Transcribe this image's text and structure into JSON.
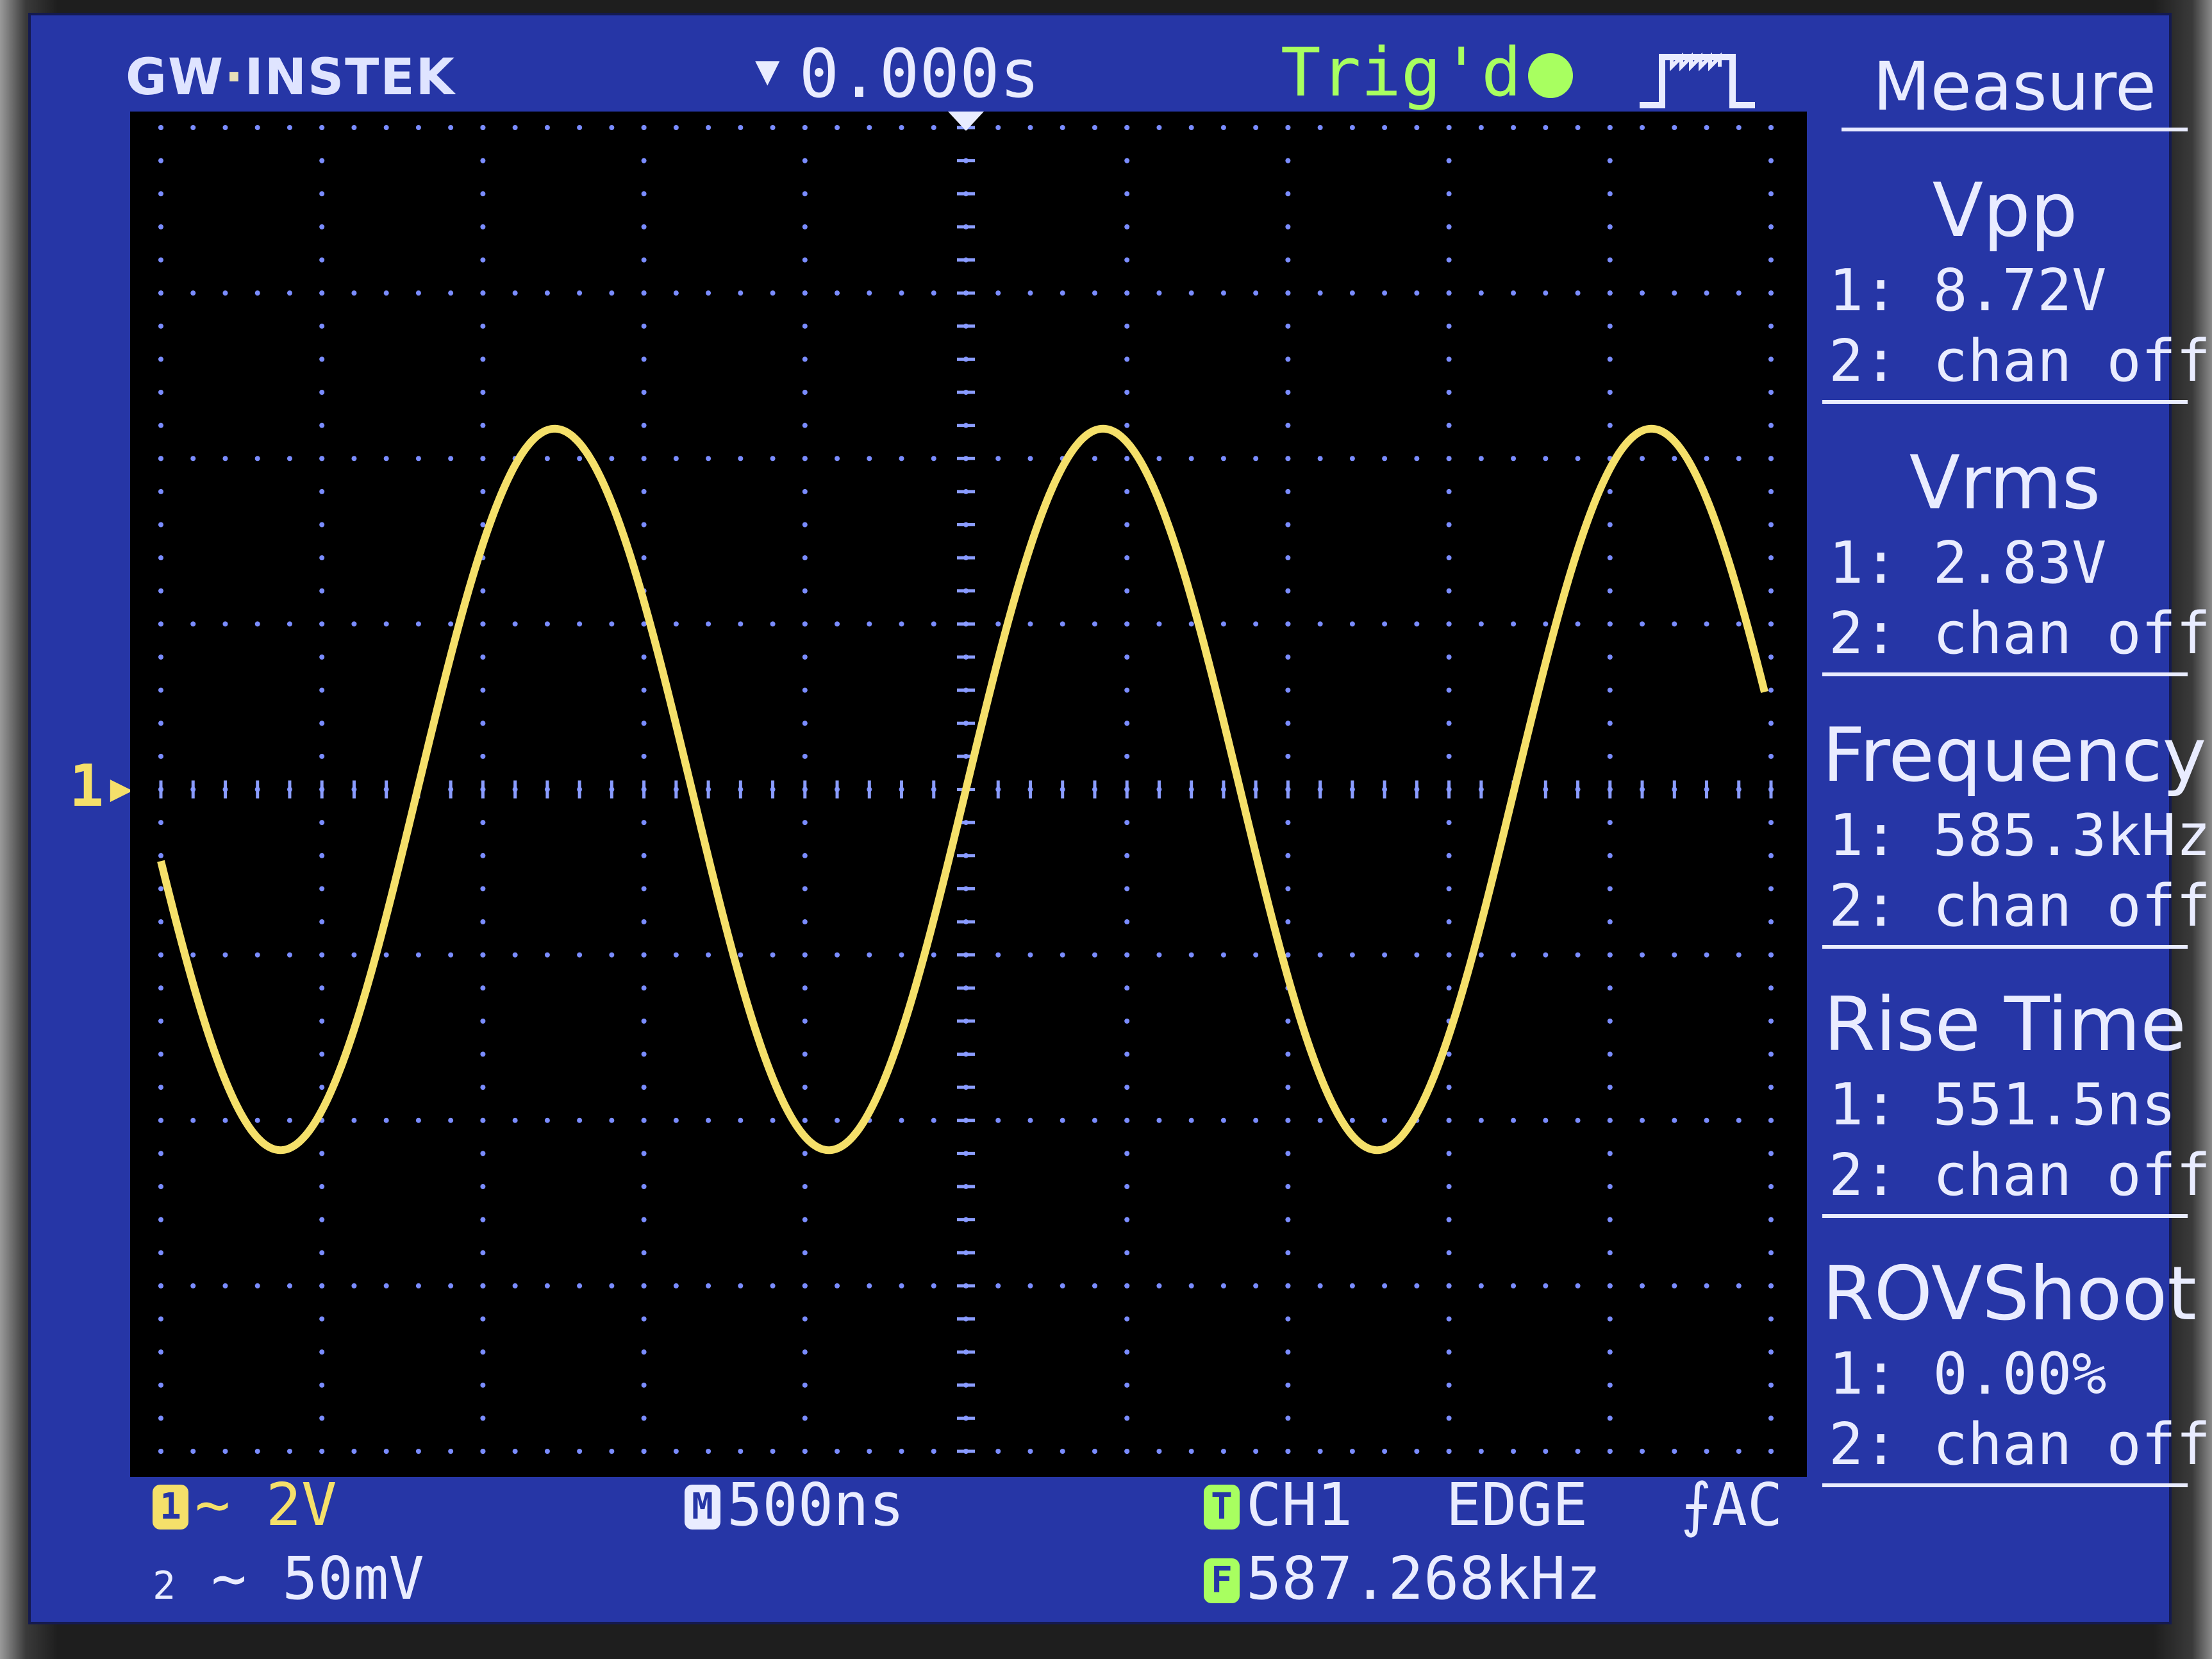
{
  "brand": {
    "left": "GW",
    "right": "INSTEK"
  },
  "header": {
    "timebase_position": "0.000s",
    "trigger_status": "Trig'd"
  },
  "menu_title": "Measure",
  "measurements": [
    {
      "name": "Vpp",
      "ch1": "1: 8.72V",
      "ch2": "2: chan off"
    },
    {
      "name": "Vrms",
      "ch1": "1: 2.83V",
      "ch2": "2: chan off"
    },
    {
      "name": "Frequency",
      "ch1": "1: 585.3kHz",
      "ch2": "2: chan off"
    },
    {
      "name": "Rise Time",
      "ch1": "1: 551.5ns",
      "ch2": "2: chan off"
    },
    {
      "name": "ROVShoot",
      "ch1": "1: 0.00%",
      "ch2": "2: chan off"
    }
  ],
  "channel1": {
    "badge": "1",
    "coupling": "∼",
    "scale": "2V",
    "ground_marker": "1"
  },
  "channel2": {
    "badge": "2",
    "coupling": "∼",
    "scale": "50mV"
  },
  "timebase": {
    "badge": "M",
    "scale": "500ns"
  },
  "trigger": {
    "badge": "T",
    "source": "CH1",
    "type": "EDGE",
    "slope": "⨍",
    "coupling": "AC"
  },
  "counter": {
    "badge": "F",
    "frequency": "587.268kHz"
  },
  "chart_data": {
    "type": "line",
    "series": [
      {
        "values_description_free": true,
        "frequency_hz": 587268,
        "amplitude_v": 4.36,
        "offset_v": 0
      }
    ],
    "volts_per_div": 2,
    "seconds_per_div": 5e-07,
    "divisions_x": 10,
    "divisions_y": 8,
    "grid": true
  },
  "colors": {
    "screen": "#2636a6",
    "trace": "#f5e06a",
    "status": "#a8ff60",
    "text": "#e9ecff"
  }
}
